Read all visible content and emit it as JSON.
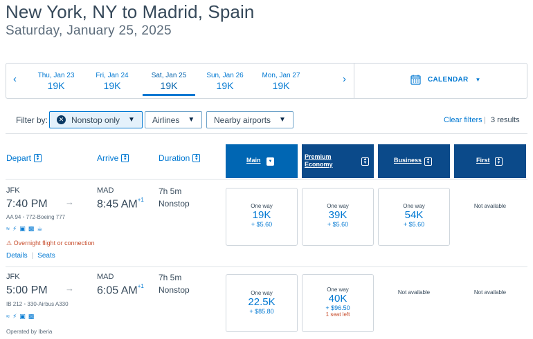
{
  "header": {
    "route": "New York, NY to Madrid, Spain",
    "date": "Saturday, January 25, 2025"
  },
  "date_strip": {
    "prev_icon": "chevron-left-icon",
    "next_icon": "chevron-right-icon",
    "days": [
      {
        "label": "Thu, Jan 23",
        "price": "19K"
      },
      {
        "label": "Fri, Jan 24",
        "price": "19K"
      },
      {
        "label": "Sat, Jan 25",
        "price": "19K"
      },
      {
        "label": "Sun, Jan 26",
        "price": "19K"
      },
      {
        "label": "Mon, Jan 27",
        "price": "19K"
      }
    ],
    "selected_index": 2,
    "calendar_label": "CALENDAR",
    "calendar_icon": "calendar-icon"
  },
  "filters": {
    "label": "Filter by:",
    "nonstop": "Nonstop only",
    "airlines": "Airlines",
    "nearby": "Nearby airports",
    "clear": "Clear filters",
    "separator": "|",
    "results": "3 results"
  },
  "columns": {
    "depart": "Depart",
    "arrive": "Arrive",
    "duration": "Duration",
    "main": "Main",
    "premium_line1": "Premium",
    "premium_line2": "Economy",
    "business": "Business",
    "first": "First"
  },
  "colors": {
    "accent": "#0078d2",
    "main_header": "#0066b3",
    "cabin_header": "#0b4a8a",
    "warning": "#c74d2c"
  },
  "flights": [
    {
      "from": "JFK",
      "depart_time": "7:40 PM",
      "to": "MAD",
      "arrive_time": "8:45 AM",
      "arrive_offset": "+1",
      "duration": "7h 5m",
      "stops": "Nonstop",
      "flight_number": "AA 94",
      "dot": "•",
      "aircraft": "772-Boeing 777",
      "amenities": [
        "wifi-icon",
        "power-icon",
        "entertainment-icon",
        "seat-icon",
        "drink-icon"
      ],
      "warning": "Overnight flight or connection",
      "details": "Details",
      "seats_link": "Seats",
      "fares": {
        "main": {
          "label": "One way",
          "miles": "19K",
          "fee": "+ $5.60"
        },
        "premium": {
          "label": "One way",
          "miles": "39K",
          "fee": "+ $5.60"
        },
        "business": {
          "label": "One way",
          "miles": "54K",
          "fee": "+ $5.60"
        },
        "first": "Not available"
      }
    },
    {
      "from": "JFK",
      "depart_time": "5:00 PM",
      "to": "MAD",
      "arrive_time": "6:05 AM",
      "arrive_offset": "+1",
      "duration": "7h 5m",
      "stops": "Nonstop",
      "flight_number": "IB 212",
      "dot": "•",
      "aircraft": "330-Airbus A330",
      "amenities": [
        "wifi-icon",
        "power-icon",
        "entertainment-icon",
        "seat-icon"
      ],
      "operated_by": "Operated by Iberia",
      "fares": {
        "main": {
          "label": "One way",
          "miles": "22.5K",
          "fee": "+ $85.80"
        },
        "premium": {
          "label": "One way",
          "miles": "40K",
          "fee": "+ $96.50",
          "seats_left": "1 seat left"
        },
        "business": "Not available",
        "first": "Not available"
      }
    }
  ]
}
